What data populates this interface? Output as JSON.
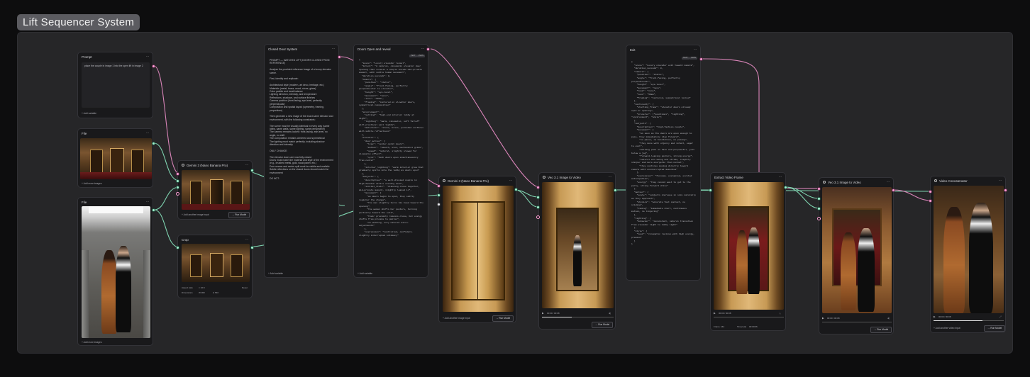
{
  "group": {
    "title": "Lift Sequencer System"
  },
  "nodes": {
    "prompt": {
      "title": "Prompt",
      "text": "place the couple in image 1 into the open lift in image 2",
      "footer": "Add variable"
    },
    "file1": {
      "title": "File",
      "footer": "Add more images"
    },
    "file2": {
      "title": "File",
      "footer": "Add more images"
    },
    "gemini_a": {
      "title": "Gemini 3 (Nano Banana Pro)",
      "add_input": "Add another image input",
      "run": "Run Model"
    },
    "crop": {
      "title": "Crop",
      "aspect_label": "Aspect ratio",
      "aspect_value": "Reset",
      "dim_label": "Dimensions",
      "w_value": "960",
      "h_value": "540",
      "w_prefix": "W",
      "h_prefix": "H"
    },
    "closed_door": {
      "title": "Closed Door System",
      "text": "PROMPT — MATCHED LIFT (DOORS CLOSED FROM REFERENCE)\n\nAnalyze the provided reference image of a luxury elevator scene.\n\nFirst, identify and replicate:\n\nArchitectural style (modern, art deco, heritage, etc.)\nMaterials (metal, brass, wood, stone, glass)\nColor palette and tonal balance\nLighting direction, intensity, and temperature\nReflections, shadows, and surface finishes\nCamera position (front-facing, eye-level, perfectly perpendicular)\nComposition and spatial layout (symmetry, framing, proportions)\n\nThen generate a new image of the exact same elevator and environment, with the following constraints:\n\nThe scene must be visually identical in every way (same lobby, same walls, same lighting, same perspective)\nThe camera remains locked: front-facing, eye-level, no angle, no shift\nThe composition remains centered and symmetrical\nThe lighting must match perfectly, including shadow direction and intensity\n\nONLY CHANGE:\n\nThe elevator doors are now fully closed\nDoors must match the material and style of the environment (e.g., brushed metal, gold, wood panel, etc.)\nDoor seams and center split must be visible and realistic\nSubtle reflections on the closed doors should match the environment\n\nDO NOT:",
      "footer": "Add variable"
    },
    "doors_open": {
      "title": "Doors Open and reveal",
      "text": "{\n  \"scene\": \"Luxury elevator reveal\",\n  \"intent\": \"A natural, cinematic elevator door opening that reveals a couple inside mid-private moment, with subtle human movement\",\n  \"duration_seconds\": 8,\n  \"camera\": {\n    \"position\": \"static\",\n    \"angle\": \"front-facing, perfectly perpendicular to elevator\",\n    \"height\": \"eye-level\",\n    \"movement\": \"none\",\n    \"lens\": \"50mm\",\n    \"framing\": \"centered on elevator doors, symmetrical composition\"\n  },\n  \"environment\": {\n    \"setting\": \"high-end interior lobby at night\",\n    \"lighting\": \"warm, cinematic, soft falloff with practical wall lights\",\n    \"materials\": \"stone, brass, polished surfaces with subtle reflections\"\n  },\n  \"elevator\": {\n    \"door_action\": {\n      \"type\": \"center-split doors\",\n      \"motion\": \"smooth, even, mechanical glide\",\n      \"speed\": \"natural, slightly slowed for cinematic effect\",\n      \"sync\": \"both doors open simultaneously from center\"\n    },\n    \"interior_lighting\": \"warm interior glow that gradually spills into the lobby as doors open\"\n  },\n  \"subjects\": {\n    \"description\": \"a well-dressed couple in high-fashion attire evening wear\",\n    \"initial_state\": \"standing close together, mid-private moment, slightly leaned in\",\n    \"movement\": [\n      \"as doors begin to open, they subtly register the change\",\n      \"the man slightly turns his head toward the opening\",\n      \"the woman shifts her posture, turning partially toward the exit\",\n      \"their proximity remains close, but energy shifts from private to public\",\n      \"no walking, only natural micro-adjustments\"\n    ],\n    \"expression\": \"controlled, confident, slightly interrupted intimacy\"",
      "tag1": "TEXT",
      "tag2": "JSON",
      "footer": "Add variable"
    },
    "gemini_b": {
      "title": "Gemini 3 (Nano Banana Pro)",
      "add_input": "Add another image input",
      "run": "Run Model"
    },
    "veo_a": {
      "title": "Veo 3.1 Image to Video",
      "time": "00:00 / 00:08",
      "run": "Run Model"
    },
    "exit": {
      "title": "Exit",
      "text": "{\n  \"scene\": \"Luxury elevator exit toward camera\",\n  \"duration_seconds\": 8,\n  \"camera\": {\n    \"position\": \"static\",\n    \"angle\": \"front-facing, perfectly perpendicular\",\n    \"height\": \"eye-level\",\n    \"movement\": \"none\",\n    \"zoom\": \"none\",\n    \"lens\": \"50mm\",\n    \"framing\": \"centered, symmetrical locked\"\n  },\n  \"continuity\": {\n    \"starting_frame\": \"elevator doors already open or opening\",\n    \"preserve\": [\"positions\", \"lighting\", \"environment\", \"scale\"]\n  },\n  \"subjects\": {\n    \"description\": \"high-fashion couple\",\n    \"movement\": [\n      \"as soon as the doors are open enough to pass, they immediately step forward\",\n      \"no pause, no hesitation, no posing\",\n      \"they move with urgency and intent, eager to exit\",\n      \"walking pace is fast and purposeful, just below a jog\",\n      \"forward-leaning posture, strong energy\",\n      \"natural arm swing and stride, slightly sharper and more energetic than normal\",\n      \"they continue moving directly toward camera with uninterrupted momentum\"\n    ],\n    \"expression\": \"focused, energized, excited anticipation\",\n    \"energy\": \"they cannot wait to get to the party, strong forward drive\"\n  },\n  \"motion\": {\n    \"scale\": \"subjects increase in size naturally as they approach\",\n    \"physics\": \"accurate foot contact, no sliding\",\n    \"timing\": \"immediate start, continuous motion, no lingering\"\n  },\n  \"lighting\": {\n    \"behavior\": \"consistent, natural transition from elevator light to lobby light\"\n  },\n  \"style\": {\n    \"look\": \"cinematic realism with high energy, premium\"\n  }\n}",
      "tag1": "TEXT",
      "tag2": "JSON"
    },
    "extract": {
      "title": "Extract Video Frame",
      "time": "00:00 / 00:08",
      "frame_label": "Frame",
      "frame_value": "164",
      "alt_label": "Timecode",
      "alt_value": "00:00:06"
    },
    "veo_b": {
      "title": "Veo 3.1 Image to Video",
      "time": "00:00 / 00:08",
      "run": "Run Model"
    },
    "concat": {
      "title": "Video Concatenator",
      "time": "00:00 / 00:08",
      "add_input": "Add another video input",
      "run": "Run Model"
    }
  },
  "colors": {
    "canvas": "#262628",
    "node": "#19191b",
    "wire_pink": "#d884b8",
    "wire_green": "#7fd3b0"
  },
  "icons": [
    "ellipsis-icon",
    "play-icon",
    "gemini-icon",
    "video-icon",
    "plus-icon",
    "fullscreen-icon",
    "volume-icon",
    "download-icon"
  ]
}
